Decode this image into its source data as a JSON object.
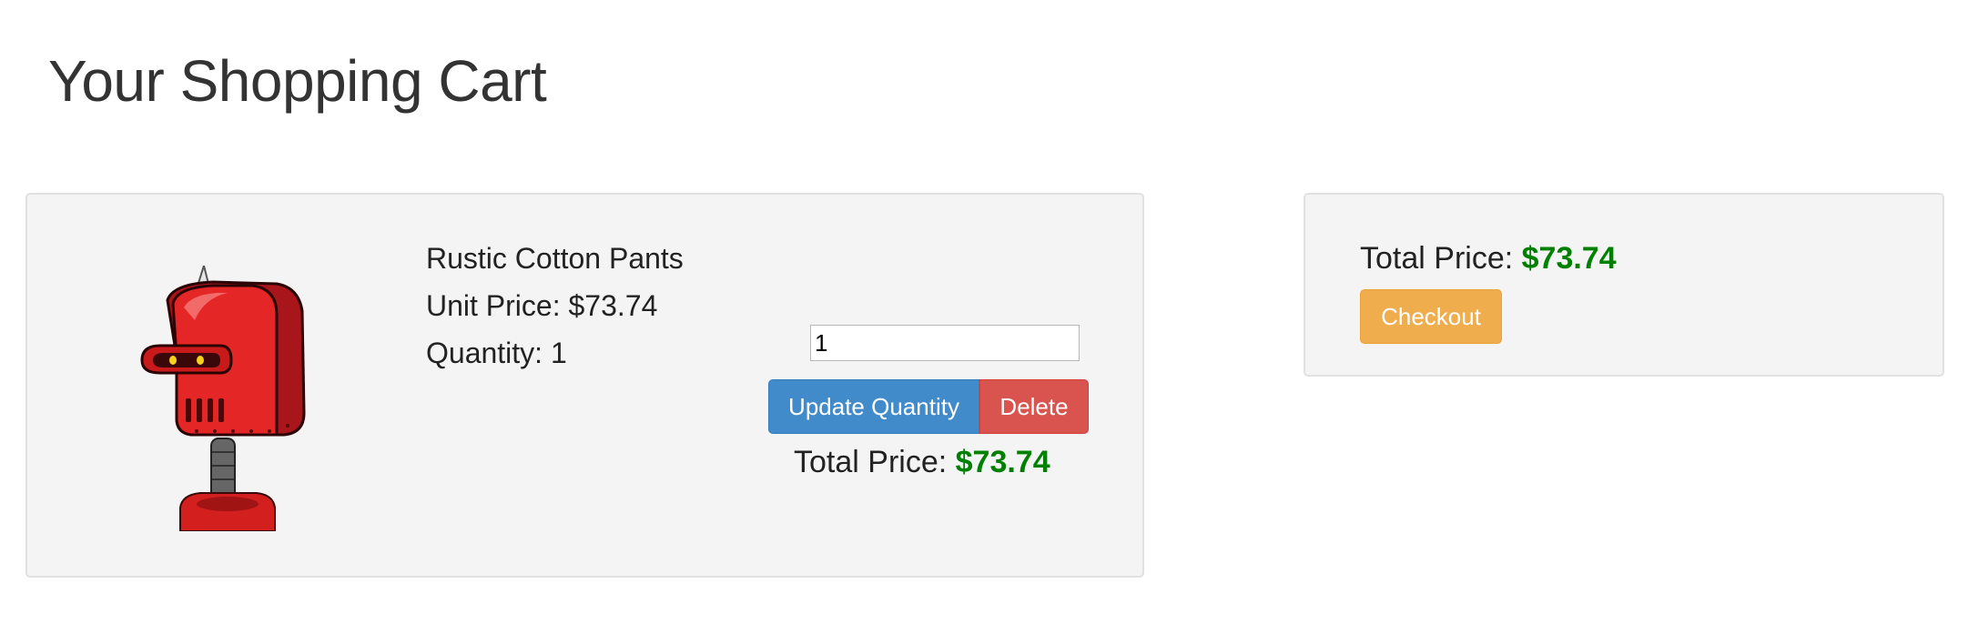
{
  "page": {
    "title": "Your Shopping Cart"
  },
  "cart": {
    "items": [
      {
        "name": "Rustic Cotton Pants",
        "unit_price_label": "Unit Price: $73.74",
        "quantity_label": "Quantity: 1",
        "quantity_value": "1",
        "update_label": "Update Quantity",
        "delete_label": "Delete",
        "total_label": "Total Price: ",
        "total_value": "$73.74",
        "image_icon": "red-robot-head"
      }
    ]
  },
  "summary": {
    "total_label": "Total Price: ",
    "total_value": "$73.74",
    "checkout_label": "Checkout"
  },
  "colors": {
    "price_green": "#008000",
    "primary": "#428bca",
    "danger": "#d9534f",
    "warning": "#f0ad4e"
  }
}
